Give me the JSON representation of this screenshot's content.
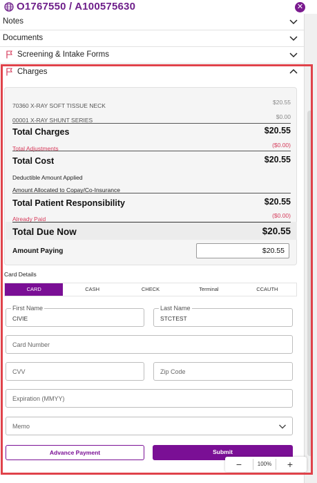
{
  "header": {
    "title": "O1767550 / A100575630",
    "globe_icon": "globe-icon",
    "close_icon": "close-icon"
  },
  "accordion": {
    "notes": "Notes",
    "documents": "Documents",
    "screening": "Screening & Intake Forms",
    "charges": "Charges"
  },
  "charges": {
    "items": [
      {
        "label": "70360 X-RAY SOFT TISSUE NECK",
        "amount": "$20.55"
      },
      {
        "label": "00001 X-RAY SHUNT SERIES",
        "amount": "$0.00"
      }
    ],
    "total_charges_label": "Total Charges",
    "total_charges": "$20.55",
    "total_adjustments_label": "Total Adjustments",
    "total_adjustments": "($0.00)",
    "total_cost_label": "Total Cost",
    "total_cost": "$20.55",
    "deductible_label": "Deductible Amount Applied",
    "copay_label": "Amount Allocated to Copay/Co-Insurance",
    "patient_resp_label": "Total Patient Responsibility",
    "patient_resp": "$20.55",
    "already_paid_label": "Already Paid",
    "already_paid": "($0.00)",
    "total_due_label": "Total Due Now",
    "total_due": "$20.55",
    "amount_paying_label": "Amount Paying",
    "amount_paying": "$20.55"
  },
  "card": {
    "section_label": "Card Details",
    "tabs": [
      "CARD",
      "CASH",
      "CHECK",
      "Terminal",
      "CCAUTH"
    ],
    "first_name_label": "First Name",
    "first_name": "CIVIE",
    "last_name_label": "Last Name",
    "last_name": "STCTEST",
    "card_number_ph": "Card Number",
    "cvv_ph": "CVV",
    "zip_ph": "Zip Code",
    "expiration_ph": "Expiration (MMYY)",
    "memo_ph": "Memo"
  },
  "buttons": {
    "advance_payment": "Advance Payment",
    "submit": "Submit"
  },
  "zoom": {
    "minus": "−",
    "value": "100%",
    "plus": "+"
  },
  "colors": {
    "accent": "#7a0f95",
    "alert_red": "#d63a5a",
    "highlight": "#e0424a"
  }
}
